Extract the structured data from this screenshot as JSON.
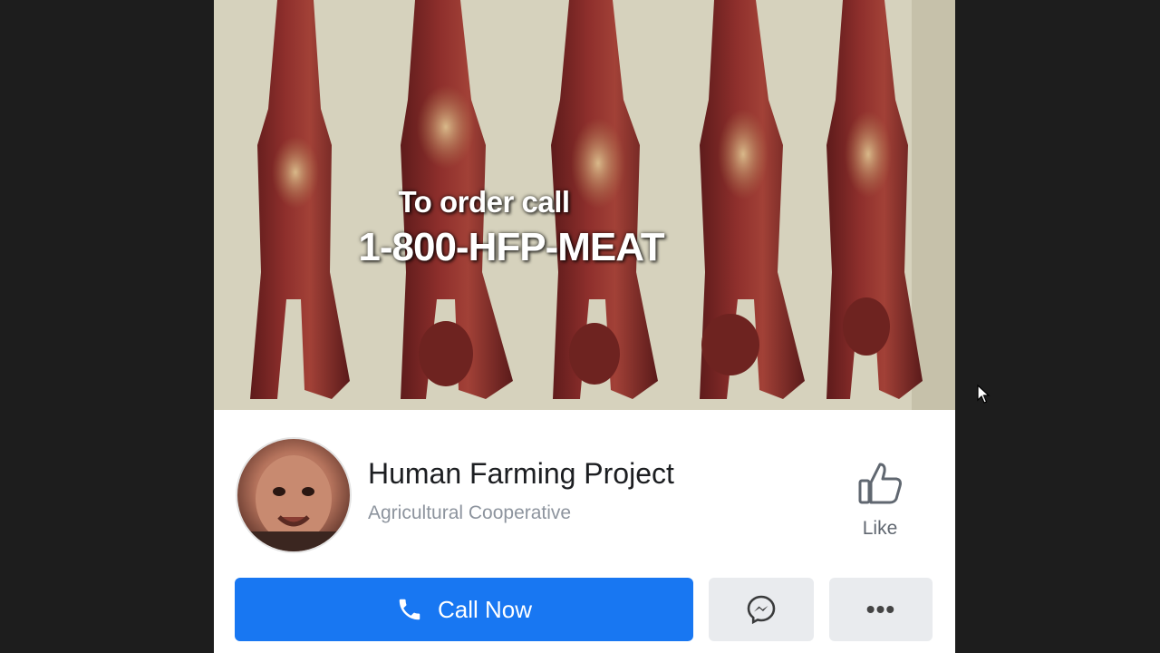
{
  "cover": {
    "caption_line1": "To order call",
    "caption_line2": "1-800-HFP-MEAT"
  },
  "page": {
    "name": "Human Farming Project",
    "category": "Agricultural Cooperative",
    "avatar_icon": "baby-face-avatar"
  },
  "like": {
    "label": "Like",
    "icon": "thumbs-up-icon"
  },
  "actions": {
    "call_label": "Call Now",
    "call_icon": "phone-icon",
    "messenger_icon": "messenger-icon",
    "more_icon": "more-dots-icon",
    "more_glyph": "•••"
  },
  "colors": {
    "primary_button": "#1877f2",
    "secondary_button": "#e9ebee",
    "background": "#1d1d1d",
    "text_primary": "#1c1e21",
    "text_secondary": "#8d949e"
  }
}
